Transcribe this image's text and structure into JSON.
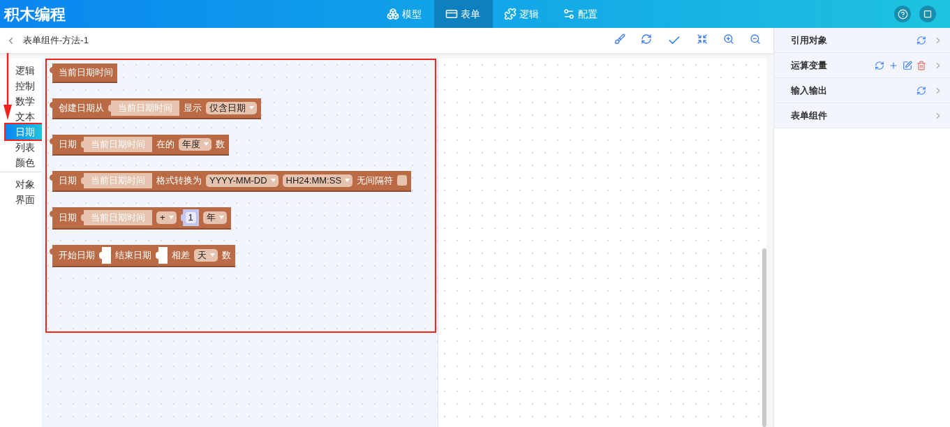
{
  "app": {
    "title": "积木编程"
  },
  "nav": [
    {
      "label": "模型",
      "selected": false
    },
    {
      "label": "表单",
      "selected": true
    },
    {
      "label": "逻辑",
      "selected": false
    },
    {
      "label": "配置",
      "selected": false
    }
  ],
  "editor": {
    "title": "表单组件-方法-1"
  },
  "category_groups": [
    [
      {
        "label": "逻辑",
        "selected": false
      },
      {
        "label": "控制",
        "selected": false
      },
      {
        "label": "数学",
        "selected": false
      },
      {
        "label": "文本",
        "selected": false
      },
      {
        "label": "日期",
        "selected": true
      },
      {
        "label": "列表",
        "selected": false
      },
      {
        "label": "颜色",
        "selected": false
      }
    ],
    [
      {
        "label": "对象",
        "selected": false
      },
      {
        "label": "界面",
        "selected": false
      }
    ]
  ],
  "blocks": [
    {
      "parts": [
        {
          "kind": "label",
          "text": "当前日期时间"
        }
      ]
    },
    {
      "parts": [
        {
          "kind": "label",
          "text": "创建日期从"
        },
        {
          "kind": "slot",
          "text": "当前日期时间"
        },
        {
          "kind": "label",
          "text": "显示"
        },
        {
          "kind": "dropdown",
          "text": "仅含日期"
        }
      ]
    },
    {
      "parts": [
        {
          "kind": "label",
          "text": "日期"
        },
        {
          "kind": "slot",
          "text": "当前日期时间"
        },
        {
          "kind": "label",
          "text": "在的"
        },
        {
          "kind": "dropdown",
          "text": "年度"
        },
        {
          "kind": "label",
          "text": "数"
        }
      ]
    },
    {
      "parts": [
        {
          "kind": "label",
          "text": "日期"
        },
        {
          "kind": "slot",
          "text": "当前日期时间"
        },
        {
          "kind": "label",
          "text": "格式转换为"
        },
        {
          "kind": "dropdown",
          "text": "YYYY-MM-DD"
        },
        {
          "kind": "dropdown",
          "text": "HH24:MM:SS"
        },
        {
          "kind": "label",
          "text": "无间隔符"
        },
        {
          "kind": "checkbox",
          "checked": false
        }
      ]
    },
    {
      "parts": [
        {
          "kind": "label",
          "text": "日期"
        },
        {
          "kind": "slot",
          "text": "当前日期时间"
        },
        {
          "kind": "dropdown",
          "text": "+"
        },
        {
          "kind": "number",
          "text": "1"
        },
        {
          "kind": "dropdown",
          "text": "年"
        }
      ]
    },
    {
      "parts": [
        {
          "kind": "label",
          "text": "开始日期"
        },
        {
          "kind": "empty"
        },
        {
          "kind": "label",
          "text": "结束日期"
        },
        {
          "kind": "empty"
        },
        {
          "kind": "label",
          "text": "相差"
        },
        {
          "kind": "dropdown",
          "text": "天"
        },
        {
          "kind": "label",
          "text": "数"
        }
      ]
    }
  ],
  "panel": [
    {
      "label": "引用对象"
    },
    {
      "label": "运算变量"
    },
    {
      "label": "输入输出"
    },
    {
      "label": "表单组件"
    }
  ]
}
